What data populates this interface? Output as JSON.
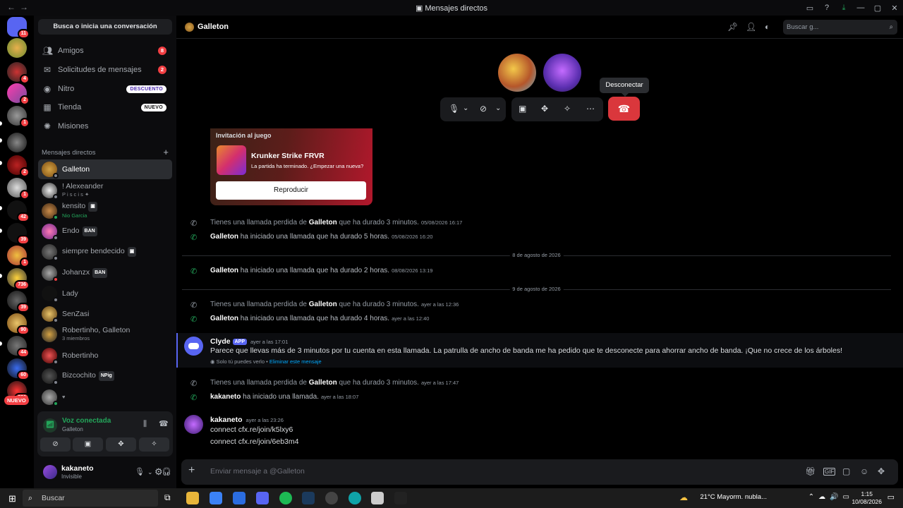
{
  "window": {
    "title": "Mensajes directos"
  },
  "guilds": {
    "badges": [
      "11",
      "4",
      "2",
      "1",
      "2",
      "1",
      "42",
      "39",
      "1",
      "736",
      "39",
      "90",
      "44",
      "60",
      "530"
    ],
    "new_label": "NUEVO"
  },
  "sidebar": {
    "search_label": "Busca o inicia una conversación",
    "nav": [
      {
        "label": "Amigos",
        "badge": "8"
      },
      {
        "label": "Solicitudes de mensajes",
        "badge": "2"
      },
      {
        "label": "Nitro",
        "pill": "DESCUENTO"
      },
      {
        "label": "Tienda",
        "pill": "NUEVO"
      },
      {
        "label": "Misiones"
      }
    ],
    "dm_header": "Mensajes directos",
    "dms": [
      {
        "name": "Galleton"
      },
      {
        "name": "! Alexeander",
        "sub": "P i s c i s ✦"
      },
      {
        "name": "kensito",
        "sub": "Nio Garcia"
      },
      {
        "name": "Endo",
        "tag": "BAN"
      },
      {
        "name": "siempre bendecido"
      },
      {
        "name": "Johanzx",
        "tag": "BAN"
      },
      {
        "name": "Lady"
      },
      {
        "name": "SenZasi"
      },
      {
        "name": "Robertinho, Galleton",
        "sub": "3 miembros"
      },
      {
        "name": "Robertinho"
      },
      {
        "name": "Bizcochito",
        "tag": "NPig"
      },
      {
        "name": "",
        "sub": "♥"
      }
    ]
  },
  "voice": {
    "status": "Voz conectada",
    "channel": "Galleton"
  },
  "user": {
    "name": "kakaneto",
    "status": "Invisible"
  },
  "channel": {
    "name": "Galleton",
    "search_placeholder": "Buscar g..."
  },
  "call": {
    "tooltip": "Desconectar"
  },
  "invite": {
    "title": "Invitación al juego",
    "game": "Krunker Strike FRVR",
    "status": "La partida ha terminado. ¿Empezar una nueva?",
    "button": "Reproducir"
  },
  "messages": [
    {
      "pre": "Tienes una llamada perdida de ",
      "who": "Galleton",
      "post": " que ha durado 3 minutos.",
      "ts": "05/08/2026 16:17",
      "missed": true
    },
    {
      "pre": "",
      "who": "Galleton",
      "post": " ha iniciado una llamada que ha durado 5 horas.",
      "ts": "05/08/2026 16:20",
      "missed": false
    },
    {
      "pre": "",
      "who": "Galleton",
      "post": " ha iniciado una llamada que ha durado 2 horas.",
      "ts": "08/08/2026 13:19",
      "missed": false
    },
    {
      "pre": "Tienes una llamada perdida de ",
      "who": "Galleton",
      "post": " que ha durado 3 minutos.",
      "ts": "ayer a las 12:36",
      "missed": true
    },
    {
      "pre": "",
      "who": "Galleton",
      "post": " ha iniciado una llamada que ha durado 4 horas.",
      "ts": "ayer a las 12:40",
      "missed": false
    },
    {
      "pre": "Tienes una llamada perdida de ",
      "who": "Galleton",
      "post": " que ha durado 3 minutos.",
      "ts": "ayer a las 17:47",
      "missed": true
    },
    {
      "pre": "",
      "who": "kakaneto",
      "post": " ha iniciado una llamada.",
      "ts": "ayer a las 18:07",
      "missed": false
    }
  ],
  "separators": [
    "8 de agosto de 2026",
    "9 de agosto de 2026"
  ],
  "clyde": {
    "author": "Clyde",
    "badge": "APP",
    "ts": "ayer a las 17:01",
    "text": "Parece que llevas más de 3 minutos por tu cuenta en esta llamada. La patrulla de ancho de banda me ha pedido que te desconecte para ahorrar ancho de banda. ¡Que no crece de los árboles!",
    "note": "Solo tú puedes verlo •",
    "dismiss": "Eliminar este mensaje"
  },
  "last": {
    "author": "kakaneto",
    "ts": "ayer a las 23:26",
    "lines": [
      "connect cfx.re/join/k5lxy6",
      "connect cfx.re/join/6eb3m4"
    ]
  },
  "composer": {
    "placeholder": "Enviar mensaje a @Galleton"
  },
  "taskbar": {
    "search": "Buscar",
    "weather": "21°C  Mayorm. nubla...",
    "time": "1:15",
    "date": "10/08/2026"
  },
  "colors": {
    "accent": "#5865f2",
    "danger": "#da373c",
    "online": "#23a55a",
    "badge": "#f23f43"
  }
}
